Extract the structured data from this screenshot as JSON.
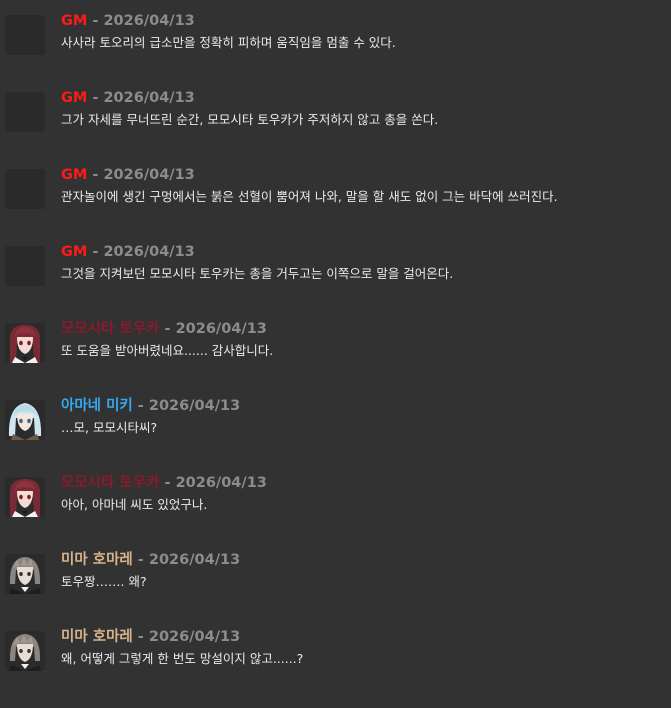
{
  "colors": {
    "background": "#323232",
    "date": "#8c8c8c",
    "text": "#eaeaea"
  },
  "messages": [
    {
      "author": "GM",
      "author_color": "#ff1a1a",
      "sep": " - ",
      "date": "2026/04/13",
      "avatar": "blank",
      "text": "사사라 토오리의 급소만을 정확히 피하며 움직임을 멈출 수 있다."
    },
    {
      "author": "GM",
      "author_color": "#ff1a1a",
      "sep": " - ",
      "date": "2026/04/13",
      "avatar": "blank",
      "text": "그가 자세를 무너뜨린 순간, 모모시타 토우카가 주저하지 않고 총을 쏜다."
    },
    {
      "author": "GM",
      "author_color": "#ff1a1a",
      "sep": " - ",
      "date": "2026/04/13",
      "avatar": "blank",
      "text": "관자놀이에 생긴 구멍에서는 붉은 선혈이 뿜어져 나와, 말을 할 새도 없이 그는 바닥에 쓰러진다."
    },
    {
      "author": "GM",
      "author_color": "#ff1a1a",
      "sep": " - ",
      "date": "2026/04/13",
      "avatar": "blank",
      "text": "그것을 지켜보던 모모시타 토우카는 총을 거두고는 이쪽으로 말을 걸어온다."
    },
    {
      "author": "모모시타 토우카",
      "author_color": "#8a1a2a",
      "sep": " - ",
      "date": "2026/04/13",
      "avatar": "toka",
      "text": "또 도움을 받아버렸네요...... 감사합니다."
    },
    {
      "author": "아마네 미키",
      "author_color": "#35a8f0",
      "sep": " - ",
      "date": "2026/04/13",
      "avatar": "miki",
      "text": "…모, 모모시타씨?"
    },
    {
      "author": "모모시타 토우카",
      "author_color": "#8a1a2a",
      "sep": " - ",
      "date": "2026/04/13",
      "avatar": "toka",
      "text": "아아, 아마네 씨도 있었구나."
    },
    {
      "author": "미마 호마레",
      "author_color": "#d7b48a",
      "sep": " - ",
      "date": "2026/04/13",
      "avatar": "homare",
      "text": "토우짱……. 왜?"
    },
    {
      "author": "미마 호마레",
      "author_color": "#d7b48a",
      "sep": " - ",
      "date": "2026/04/13",
      "avatar": "homare",
      "text": "왜, 어떻게 그렇게 한 번도 망설이지 않고......?"
    }
  ]
}
